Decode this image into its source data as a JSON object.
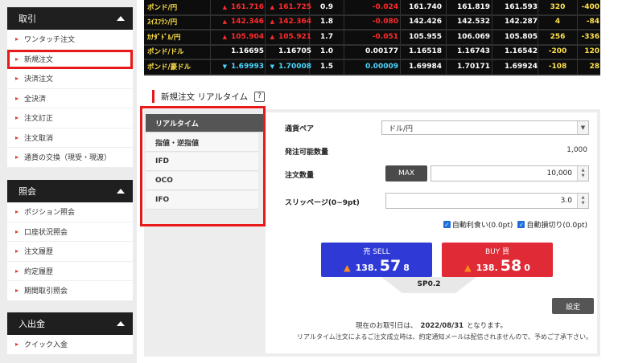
{
  "sidebar": {
    "sections": [
      {
        "title": "取引",
        "items": [
          {
            "label": "ワンタッチ注文"
          },
          {
            "label": "新規注文",
            "highlighted": true
          },
          {
            "label": "決済注文"
          },
          {
            "label": "全決済"
          },
          {
            "label": "注文訂正"
          },
          {
            "label": "注文取消"
          },
          {
            "label": "通貨の交換（現受・現渡）"
          }
        ]
      },
      {
        "title": "照会",
        "items": [
          {
            "label": "ポジション照会"
          },
          {
            "label": "口座状況照会"
          },
          {
            "label": "注文履歴"
          },
          {
            "label": "約定履歴"
          },
          {
            "label": "期間取引照会"
          }
        ]
      },
      {
        "title": "入出金",
        "items": [
          {
            "label": "クイック入金"
          }
        ]
      }
    ]
  },
  "quotes": [
    {
      "pair": "ポンド/円",
      "bid_arrow": "▲",
      "bid": "161.716",
      "ask_arrow": "▲",
      "ask": "161.725",
      "spread": "0.9",
      "change": "-0.024",
      "change_color": "#ff2b2b",
      "open": "161.740",
      "high": "161.819",
      "low": "161.593",
      "swap_buy": "320",
      "swap_sell": "-400",
      "dir": "up"
    },
    {
      "pair": "ｽｲｽﾌﾗﾝ/円",
      "bid_arrow": "▲",
      "bid": "142.346",
      "ask_arrow": "▲",
      "ask": "142.364",
      "spread": "1.8",
      "change": "-0.080",
      "change_color": "#ff2b2b",
      "open": "142.426",
      "high": "142.532",
      "low": "142.287",
      "swap_buy": "4",
      "swap_sell": "-84",
      "dir": "up"
    },
    {
      "pair": "ｶﾅﾀﾞﾄﾞﾙ/円",
      "bid_arrow": "▲",
      "bid": "105.904",
      "ask_arrow": "▲",
      "ask": "105.921",
      "spread": "1.7",
      "change": "-0.051",
      "change_color": "#ff2b2b",
      "open": "105.955",
      "high": "106.069",
      "low": "105.805",
      "swap_buy": "256",
      "swap_sell": "-336",
      "dir": "up"
    },
    {
      "pair": "ポンド/ドル",
      "bid_arrow": "",
      "bid": "1.16695",
      "ask_arrow": "",
      "ask": "1.16705",
      "spread": "1.0",
      "change": "0.00177",
      "change_color": "#ffffff",
      "open": "1.16518",
      "high": "1.16743",
      "low": "1.16542",
      "swap_buy": "-200",
      "swap_sell": "120",
      "dir": "none"
    },
    {
      "pair": "ポンド/豪ドル",
      "bid_arrow": "▼",
      "bid": "1.69993",
      "ask_arrow": "▼",
      "ask": "1.70008",
      "spread": "1.5",
      "change": "0.00009",
      "change_color": "#4ad7ff",
      "open": "1.69984",
      "high": "1.70171",
      "low": "1.69924",
      "swap_buy": "-108",
      "swap_sell": "28",
      "dir": "down"
    }
  ],
  "order_panel": {
    "title": "新規注文 リアルタイム",
    "help_icon": "?",
    "tabs": [
      {
        "label": "リアルタイム",
        "active": true
      },
      {
        "label": "指値・逆指値"
      },
      {
        "label": "IFD"
      },
      {
        "label": "OCO"
      },
      {
        "label": "IFO"
      }
    ],
    "currency_pair_label": "通貨ペア",
    "currency_pair_value": "ドル/円",
    "available_qty_label": "発注可能数量",
    "available_qty_value": "1,000",
    "qty_label": "注文数量",
    "max_button": "MAX",
    "qty_value": "10,000",
    "slippage_label": "スリッページ(0~9pt)",
    "slippage_value": "3.0",
    "auto_profit_label": "自動利食い(0.0pt)",
    "auto_loss_label": "自動損切り(0.0pt)",
    "sell": {
      "label": "売 SELL",
      "price_prefix": "138.",
      "price_big": "57",
      "price_suffix": "8"
    },
    "buy": {
      "label": "BUY 買",
      "price_prefix": "138.",
      "price_big": "58",
      "price_suffix": "0"
    },
    "spread_text": "SP0.2",
    "settings_button": "設定",
    "note_prefix": "現在のお取引日は、",
    "note_date": "2022/08/31",
    "note_suffix": "となります。",
    "note2": "リアルタイム注文によるご注文成立時は、約定通知メールは配信されませんので、予めご了承下さい。"
  },
  "colors": {
    "accent_red": "#e8191a",
    "sell_blue": "#2f3ad6",
    "buy_red": "#e02a35",
    "quote_up": "#ff2b2b",
    "quote_down": "#4ad7ff",
    "pair_yellow": "#ffe14a"
  }
}
